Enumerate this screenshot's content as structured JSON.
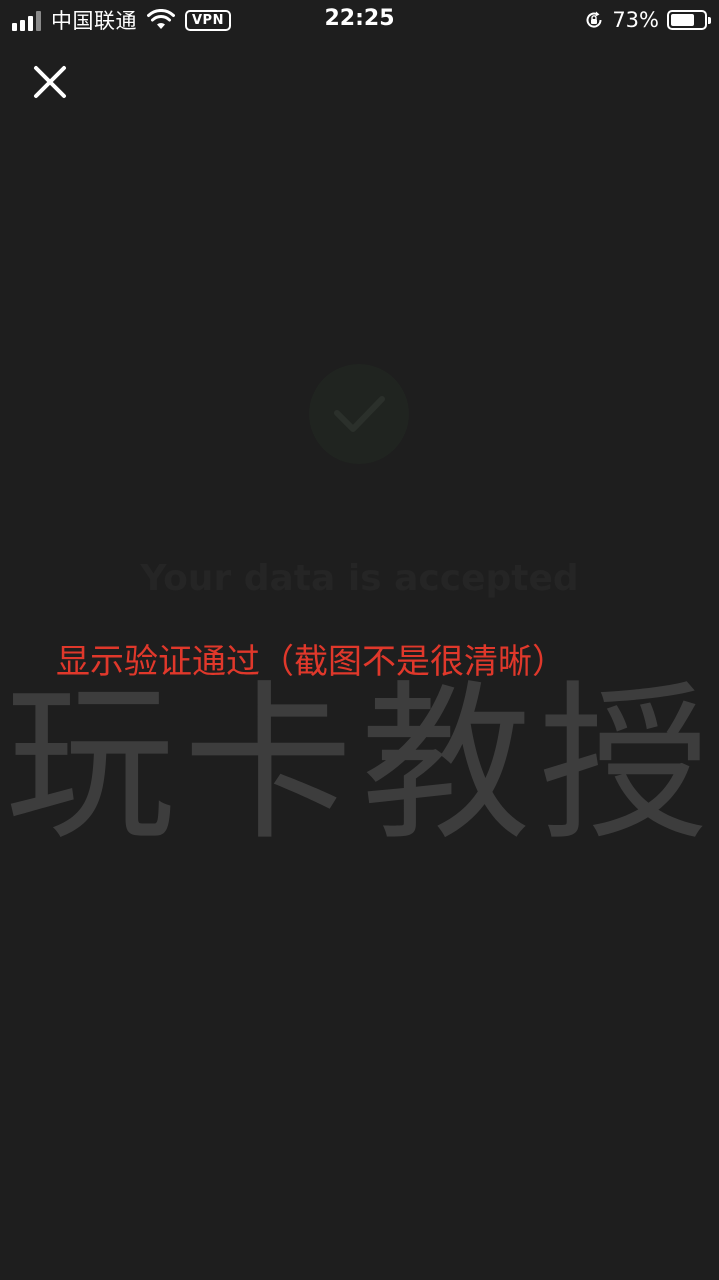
{
  "status_bar": {
    "carrier": "中国联通",
    "vpn": "VPN",
    "time": "22:25",
    "battery_percent": "73%",
    "battery_level": 0.73
  },
  "close": {
    "icon": "close-icon"
  },
  "result": {
    "icon": "checkmark-icon",
    "message": "Your data is accepted"
  },
  "annotation": {
    "text": "显示验证通过（截图不是很清晰）"
  },
  "watermark": {
    "text": "玩卡教授"
  },
  "colors": {
    "background": "#1e1e1e",
    "annotation": "#e0382b",
    "watermark": "#3d3d3d"
  }
}
